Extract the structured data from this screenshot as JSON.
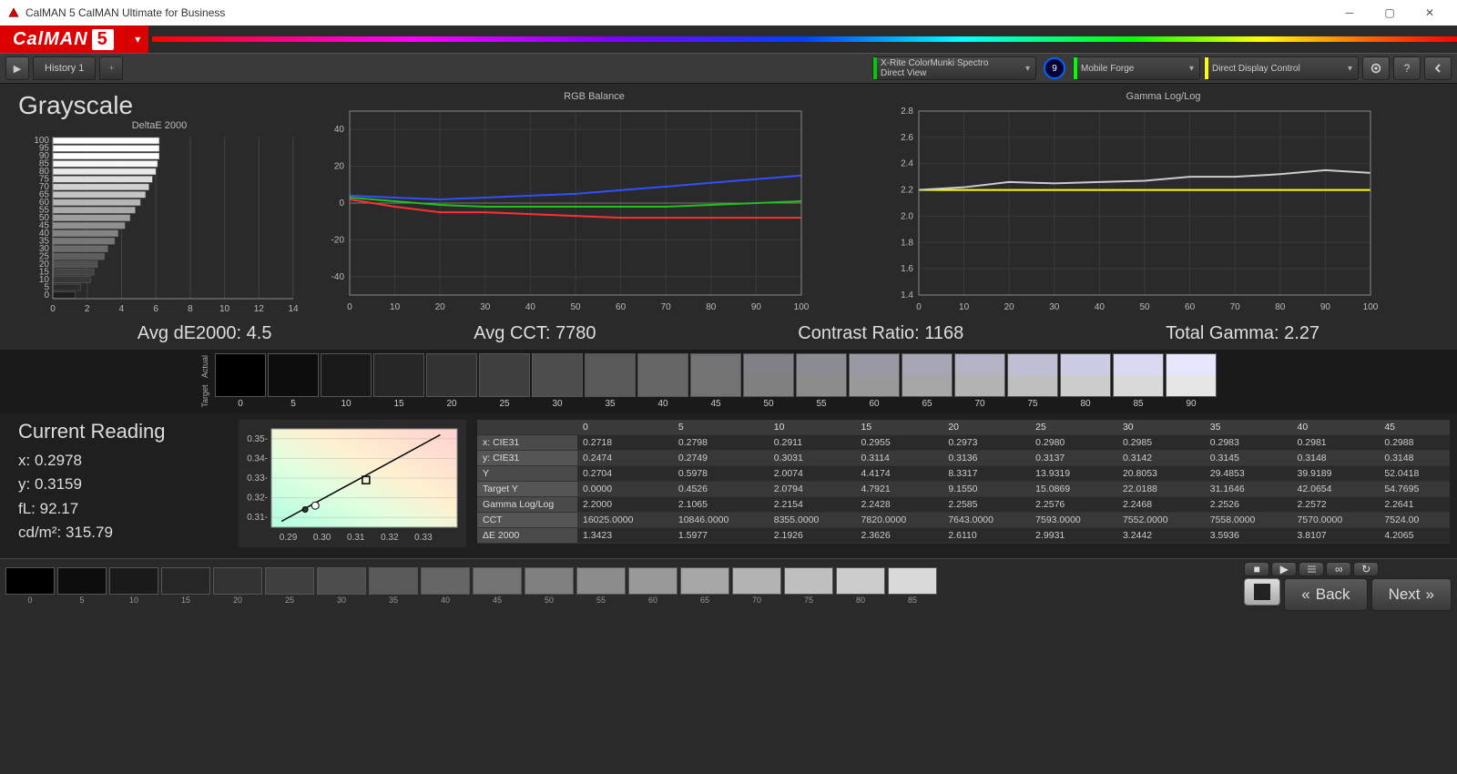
{
  "window_title": "CalMAN 5 CalMAN Ultimate for Business",
  "brand": {
    "name": "CalMAN",
    "num": "5"
  },
  "tabs": {
    "history": "History 1"
  },
  "devices": {
    "meter": {
      "line1": "X-Rite ColorMunki Spectro",
      "line2": "Direct View"
    },
    "source": "Mobile Forge",
    "display": "Direct Display Control",
    "badge": "9"
  },
  "panel_title": "Grayscale",
  "metrics": {
    "avg_de": "Avg dE2000: 4.5",
    "avg_cct": "Avg CCT: 7780",
    "contrast": "Contrast Ratio: 1168",
    "gamma": "Total Gamma: 2.27"
  },
  "swatch_header": {
    "top": "Actual",
    "bottom": "Target"
  },
  "swatch_levels": [
    0,
    5,
    10,
    15,
    20,
    25,
    30,
    35,
    40,
    45,
    50,
    55,
    60,
    65,
    70,
    75,
    80,
    85,
    90
  ],
  "reading": {
    "title": "Current Reading",
    "x": "x: 0.2978",
    "y": "y: 0.3159",
    "fl": "fL: 92.17",
    "cdm2": "cd/m²: 315.79"
  },
  "table": {
    "cols": [
      "0",
      "5",
      "10",
      "15",
      "20",
      "25",
      "30",
      "35",
      "40",
      "45"
    ],
    "rows": [
      {
        "n": "x: CIE31",
        "v": [
          "0.2718",
          "0.2798",
          "0.2911",
          "0.2955",
          "0.2973",
          "0.2980",
          "0.2985",
          "0.2983",
          "0.2981",
          "0.2988"
        ]
      },
      {
        "n": "y: CIE31",
        "v": [
          "0.2474",
          "0.2749",
          "0.3031",
          "0.3114",
          "0.3136",
          "0.3137",
          "0.3142",
          "0.3145",
          "0.3148",
          "0.3148"
        ]
      },
      {
        "n": "Y",
        "v": [
          "0.2704",
          "0.5978",
          "2.0074",
          "4.4174",
          "8.3317",
          "13.9319",
          "20.8053",
          "29.4853",
          "39.9189",
          "52.0418"
        ]
      },
      {
        "n": "Target Y",
        "v": [
          "0.0000",
          "0.4526",
          "2.0794",
          "4.7921",
          "9.1550",
          "15.0869",
          "22.0188",
          "31.1646",
          "42.0654",
          "54.7695"
        ]
      },
      {
        "n": "Gamma Log/Log",
        "v": [
          "2.2000",
          "2.1065",
          "2.2154",
          "2.2428",
          "2.2585",
          "2.2576",
          "2.2468",
          "2.2526",
          "2.2572",
          "2.2641"
        ]
      },
      {
        "n": "CCT",
        "v": [
          "16025.0000",
          "10846.0000",
          "8355.0000",
          "7820.0000",
          "7643.0000",
          "7593.0000",
          "7552.0000",
          "7558.0000",
          "7570.0000",
          "7524.00"
        ]
      },
      {
        "n": "ΔE 2000",
        "v": [
          "1.3423",
          "1.5977",
          "2.1926",
          "2.3626",
          "2.6110",
          "2.9931",
          "3.2442",
          "3.5936",
          "3.8107",
          "4.2065"
        ]
      }
    ]
  },
  "footer_levels": [
    0,
    5,
    10,
    15,
    20,
    25,
    30,
    35,
    40,
    45,
    50,
    55,
    60,
    65,
    70,
    75,
    80,
    85
  ],
  "nav": {
    "back": "Back",
    "next": "Next"
  },
  "chart_data": [
    {
      "type": "bar",
      "title": "DeltaE 2000",
      "orientation": "horizontal",
      "categories": [
        0,
        5,
        10,
        15,
        20,
        25,
        30,
        35,
        40,
        45,
        50,
        55,
        60,
        65,
        70,
        75,
        80,
        85,
        90,
        95,
        100
      ],
      "values": [
        1.3,
        1.6,
        2.2,
        2.4,
        2.6,
        3.0,
        3.2,
        3.6,
        3.8,
        4.2,
        4.5,
        4.8,
        5.1,
        5.4,
        5.6,
        5.8,
        6.0,
        6.1,
        6.2,
        6.2,
        6.2
      ],
      "xlim": [
        0,
        14
      ]
    },
    {
      "type": "line",
      "title": "RGB Balance",
      "x": [
        0,
        10,
        20,
        30,
        40,
        50,
        60,
        70,
        80,
        90,
        100
      ],
      "series": [
        {
          "name": "Red",
          "color": "#ff3030",
          "values": [
            2,
            -2,
            -5,
            -5,
            -6,
            -7,
            -8,
            -8,
            -8,
            -8,
            -8
          ]
        },
        {
          "name": "Green",
          "color": "#20c020",
          "values": [
            3,
            1,
            -1,
            -2,
            -2,
            -2,
            -2,
            -2,
            -1,
            0,
            1
          ]
        },
        {
          "name": "Blue",
          "color": "#3050ff",
          "values": [
            4,
            3,
            2,
            3,
            4,
            5,
            7,
            9,
            11,
            13,
            15
          ]
        }
      ],
      "ylim": [
        -50,
        50
      ],
      "xlim": [
        0,
        100
      ]
    },
    {
      "type": "line",
      "title": "Gamma Log/Log",
      "x": [
        0,
        10,
        20,
        30,
        40,
        50,
        60,
        70,
        80,
        90,
        100
      ],
      "series": [
        {
          "name": "Target",
          "color": "#ffff00",
          "values": [
            2.2,
            2.2,
            2.2,
            2.2,
            2.2,
            2.2,
            2.2,
            2.2,
            2.2,
            2.2,
            2.2
          ]
        },
        {
          "name": "Measured",
          "color": "#cccccc",
          "values": [
            2.2,
            2.22,
            2.26,
            2.25,
            2.26,
            2.27,
            2.3,
            2.3,
            2.32,
            2.35,
            2.33
          ]
        }
      ],
      "ylim": [
        1.4,
        2.8
      ],
      "xlim": [
        0,
        100
      ]
    }
  ],
  "cie_plot": {
    "xlim": [
      0.285,
      0.34
    ],
    "ylim": [
      0.305,
      0.355
    ],
    "xticks": [
      "0.29",
      "0.30",
      "0.31",
      "0.32",
      "0.33"
    ],
    "yticks": [
      "0.31",
      "0.32",
      "0.33",
      "0.34",
      "0.35"
    ]
  }
}
